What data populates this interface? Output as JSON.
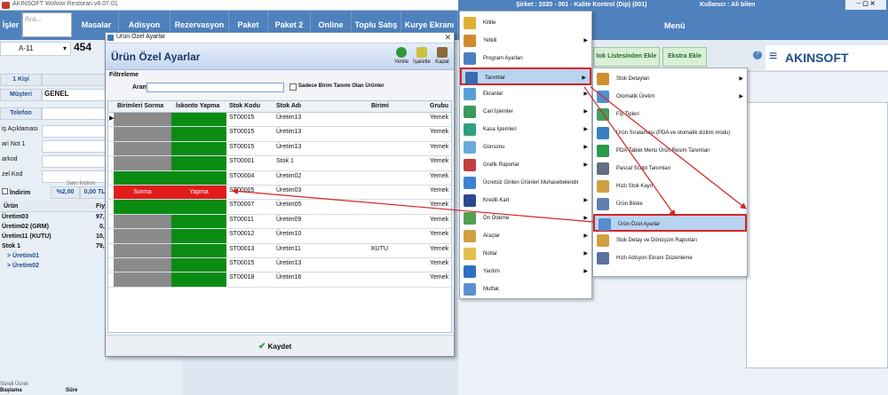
{
  "left_app": {
    "title": "AKINSOFT Wolvox Restoran v8.07.01",
    "nav": {
      "islemler": "İşler",
      "search_placeholder": "Ara...",
      "masalar": "Masalar",
      "adisyon": "Adisyon",
      "rezervasyon": "Rezervasyon",
      "paket": "Paket",
      "paket2": "Paket 2",
      "online": "Online",
      "toplu_satis": "Toplu Satış",
      "kurye_ekrani": "Kurye Ekranı"
    },
    "table_selector": "A-11",
    "table_number": "454",
    "kisi": "1 Kişi",
    "g_label": "G",
    "musteri_label": "Müşteri",
    "musteri_value": "GENEL",
    "telefon_label": "Telefon",
    "labels": {
      "aciklamasi": "iş Açıklaması",
      "not": "ari Not 1",
      "barkod": "arkod",
      "ozel_kod": "zel Kod",
      "satir_indirim": "Satır İndirim",
      "indirim": "İndirim",
      "pct": "%2,00",
      "amount": "0,00 TL",
      "urun": "Ürün",
      "fiyat": "Fiy",
      "sureli_ucret": "Süreli Ücret",
      "baslama": "Başlama",
      "sure": "Süre"
    },
    "products": [
      {
        "name": "Üretim03",
        "price": "97,"
      },
      {
        "name": "Üretim02 (GRM)",
        "price": "0,"
      },
      {
        "name": "Üretim11 (KUTU)",
        "price": "10,"
      },
      {
        "name": "Stok 1",
        "price": "79,"
      }
    ],
    "subproducts": [
      "> Üretim01",
      "> Üretim02"
    ]
  },
  "right_app": {
    "sirket": "Şirket : 2020 - 001 - Kalite Kontrol  (Dip) (001)",
    "kullanici": "Kullanıcı : Ali bilen",
    "menu_label": "Menü",
    "tabs": {
      "stok_listesi": "tok Listesinden Ekle",
      "ekstra": "Ekstra Ekle"
    },
    "logo": "AKINSOFT"
  },
  "dialog": {
    "window_title": "Ürün Özel Ayarlar",
    "header": "Ürün Özel Ayarlar",
    "toolbar": {
      "yenile": "Yenile",
      "isaretle": "İşaretle",
      "kapat": "Kapat"
    },
    "filtreleme": "Filtreleme",
    "arama_label": "Arama",
    "checkbox_label": "Sadece Birim Tanımı Olan Ürünler",
    "columns": {
      "birimleri_sorma": "Birimleri Sorma",
      "iskonto_yapma": "İskonto Yapma",
      "stok_kodu": "Stok Kodu",
      "stok_adi": "Stok Adı",
      "birimi": "Birimi",
      "grubu": "Grubu"
    },
    "rows": [
      {
        "a": "gray",
        "b": "green",
        "a_text": "",
        "b_text": "",
        "code": "ST00015",
        "name": "Üretim13",
        "unit": "",
        "group": "Yemek"
      },
      {
        "a": "gray",
        "b": "green",
        "a_text": "",
        "b_text": "",
        "code": "ST00015",
        "name": "Üretim13",
        "unit": "",
        "group": "Yemek"
      },
      {
        "a": "gray",
        "b": "green",
        "a_text": "",
        "b_text": "",
        "code": "ST00015",
        "name": "Üretim13",
        "unit": "",
        "group": "Yemek"
      },
      {
        "a": "gray",
        "b": "green",
        "a_text": "",
        "b_text": "",
        "code": "ST00001",
        "name": "Stok 1",
        "unit": "",
        "group": "Yemek"
      },
      {
        "a": "green",
        "b": "green",
        "a_text": "",
        "b_text": "",
        "code": "ST00004",
        "name": "Üretim02",
        "unit": "",
        "group": "Yemek"
      },
      {
        "a": "red",
        "b": "red",
        "a_text": "Sorma",
        "b_text": "Yapma",
        "code": "ST00005",
        "name": "Üretim03",
        "unit": "",
        "group": "Yemek"
      },
      {
        "a": "green",
        "b": "green",
        "a_text": "",
        "b_text": "",
        "code": "ST00007",
        "name": "Üretim05",
        "unit": "",
        "group": "Yemek"
      },
      {
        "a": "gray",
        "b": "green",
        "a_text": "",
        "b_text": "",
        "code": "ST00011",
        "name": "Üretim09",
        "unit": "",
        "group": "Yemek"
      },
      {
        "a": "gray",
        "b": "green",
        "a_text": "",
        "b_text": "",
        "code": "ST00012",
        "name": "Üretim10",
        "unit": "",
        "group": "Yemek"
      },
      {
        "a": "gray",
        "b": "green",
        "a_text": "",
        "b_text": "",
        "code": "ST00013",
        "name": "Üretim11",
        "unit": "KUTU",
        "group": "Yemek"
      },
      {
        "a": "gray",
        "b": "green",
        "a_text": "",
        "b_text": "",
        "code": "ST00015",
        "name": "Üretim13",
        "unit": "",
        "group": "Yemek"
      },
      {
        "a": "gray",
        "b": "green",
        "a_text": "",
        "b_text": "",
        "code": "ST00018",
        "name": "Üretim16",
        "unit": "",
        "group": "Yemek"
      }
    ],
    "save": "Kaydet"
  },
  "menu1": [
    {
      "label": "Kilitle",
      "sub": false,
      "color": "#e0b030"
    },
    {
      "label": "Yetkili",
      "sub": true,
      "color": "#d08a30"
    },
    {
      "label": "Program Ayarları",
      "sub": false,
      "color": "#4a7fc0"
    },
    {
      "label": "Tanımlar",
      "sub": true,
      "color": "#3a6ab0"
    },
    {
      "label": "Ekranlar",
      "sub": true,
      "color": "#5aa0d8"
    },
    {
      "label": "Cari İşlemler",
      "sub": true,
      "color": "#3a9a5a"
    },
    {
      "label": "Kasa İşlemleri",
      "sub": true,
      "color": "#30a080"
    },
    {
      "label": "Günsonu",
      "sub": true,
      "color": "#6aaae0"
    },
    {
      "label": "Grafik Raporlar",
      "sub": true,
      "color": "#c04040"
    },
    {
      "label": "Ücretsiz Girilen Ürünleri Muhasebelendir",
      "sub": false,
      "color": "#4080d0"
    },
    {
      "label": "Kredili Kart",
      "sub": true,
      "color": "#2a4a90"
    },
    {
      "label": "Ön Ödeme",
      "sub": true,
      "color": "#50a050"
    },
    {
      "label": "Araçlar",
      "sub": true,
      "color": "#d0a040"
    },
    {
      "label": "Notlar",
      "sub": true,
      "color": "#e0c050"
    },
    {
      "label": "Yardım",
      "sub": true,
      "color": "#3070c0"
    },
    {
      "label": "Mutfak",
      "sub": false,
      "color": "#5a90d0"
    }
  ],
  "menu2": [
    {
      "label": "Stok Detayları",
      "sub": true,
      "color": "#d09030"
    },
    {
      "label": "Otomatik Üretim",
      "sub": true,
      "color": "#5090d0"
    },
    {
      "label": "Fiş Tipleri",
      "sub": false,
      "color": "#40a060"
    },
    {
      "label": "Ürün Sıralaması (PDA ve otomatik dizilim modu)",
      "sub": false,
      "color": "#3a80c0"
    },
    {
      "label": "PDA Tablet Menü Ürün Resim Tanımları",
      "sub": false,
      "color": "#2a9a4a"
    },
    {
      "label": "Pascal Script Tanımları",
      "sub": false,
      "color": "#607080"
    },
    {
      "label": "Hızlı Stok Kayıt",
      "sub": false,
      "color": "#d0a040"
    },
    {
      "label": "Ürün Bloke",
      "sub": false,
      "color": "#6080b0"
    },
    {
      "label": "Ürün Özel Ayarlar",
      "sub": false,
      "color": "#5a8ad0"
    },
    {
      "label": "Stok Detay ve Dönüşüm Raporları",
      "sub": false,
      "color": "#d0a040"
    },
    {
      "label": "Hızlı Adisyon Ekranı Düzenleme",
      "sub": false,
      "color": "#5a70a0"
    }
  ]
}
